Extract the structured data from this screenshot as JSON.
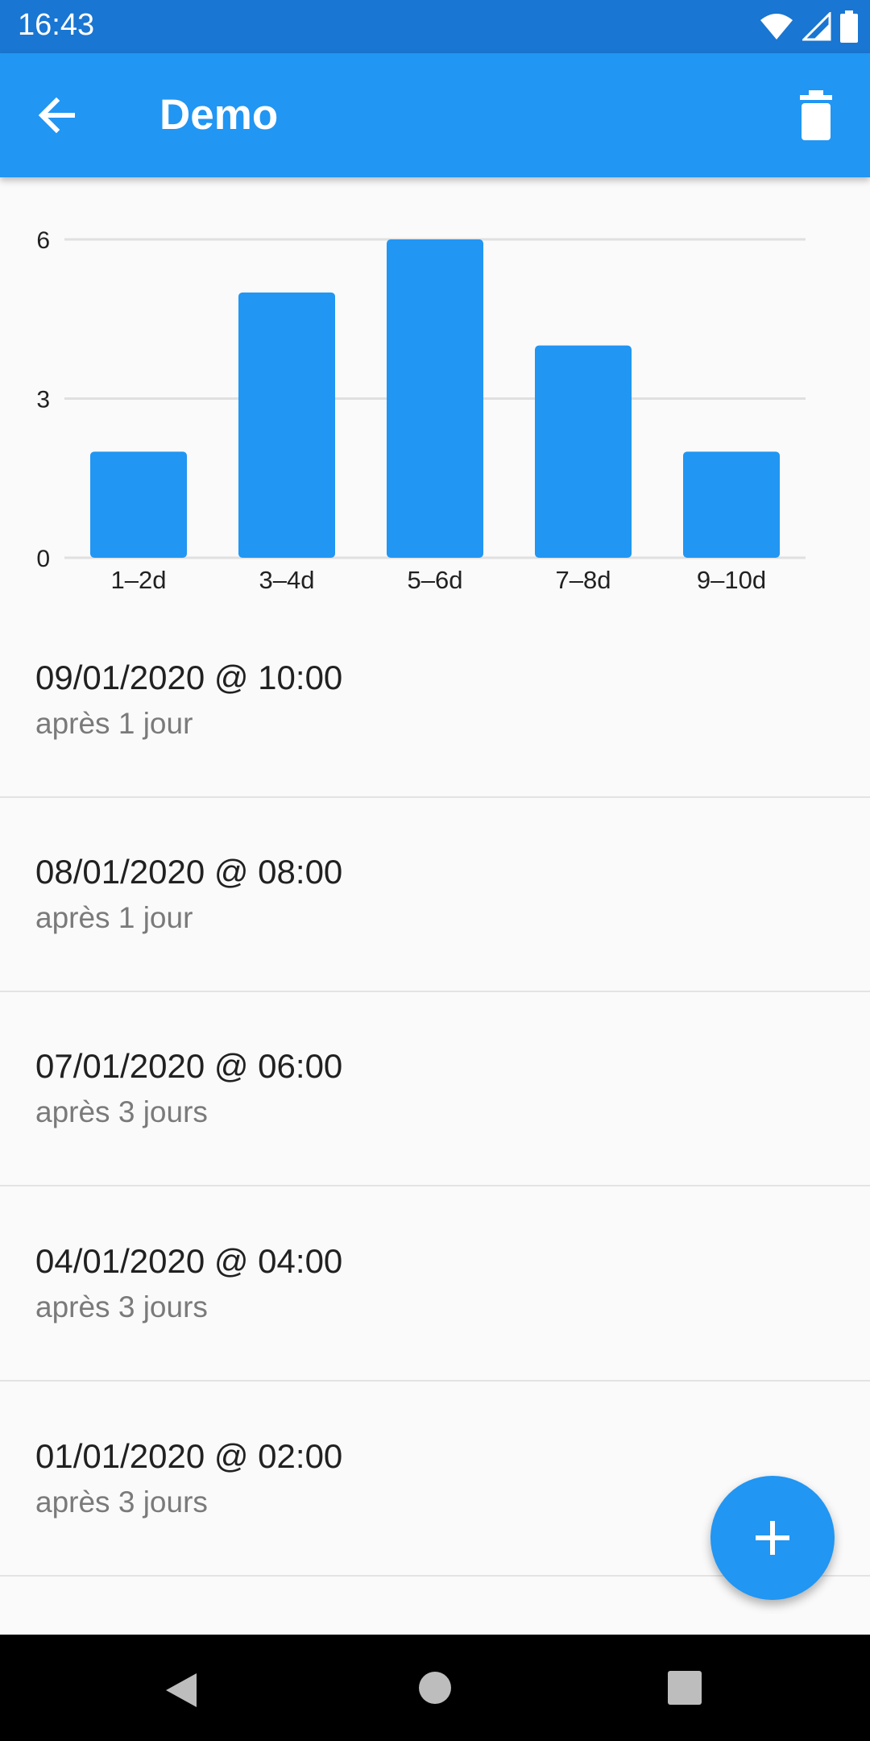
{
  "status_bar": {
    "time": "16:43"
  },
  "app_bar": {
    "title": "Demo",
    "back_icon": "arrow-back-icon",
    "delete_icon": "trash-icon"
  },
  "colors": {
    "accent": "#2196f3",
    "status_bar": "#1976d2"
  },
  "chart_data": {
    "type": "bar",
    "categories": [
      "1–2d",
      "3–4d",
      "5–6d",
      "7–8d",
      "9–10d"
    ],
    "values": [
      2,
      5,
      6,
      4,
      2
    ],
    "yticks": [
      "0",
      "3",
      "6"
    ],
    "ylim": [
      0,
      6
    ],
    "grid": true,
    "color": "#2196f3"
  },
  "list": [
    {
      "date": "09/01/2020 @ 10:00",
      "subtitle": "après 1 jour"
    },
    {
      "date": "08/01/2020 @ 08:00",
      "subtitle": "après 1 jour"
    },
    {
      "date": "07/01/2020 @ 06:00",
      "subtitle": "après 3 jours"
    },
    {
      "date": "04/01/2020 @ 04:00",
      "subtitle": "après 3 jours"
    },
    {
      "date": "01/01/2020 @ 02:00",
      "subtitle": "après 3 jours"
    }
  ],
  "fab": {
    "icon": "plus-icon"
  },
  "nav_bar": {
    "back": "back-triangle-icon",
    "home": "home-circle-icon",
    "recents": "recents-square-icon"
  }
}
